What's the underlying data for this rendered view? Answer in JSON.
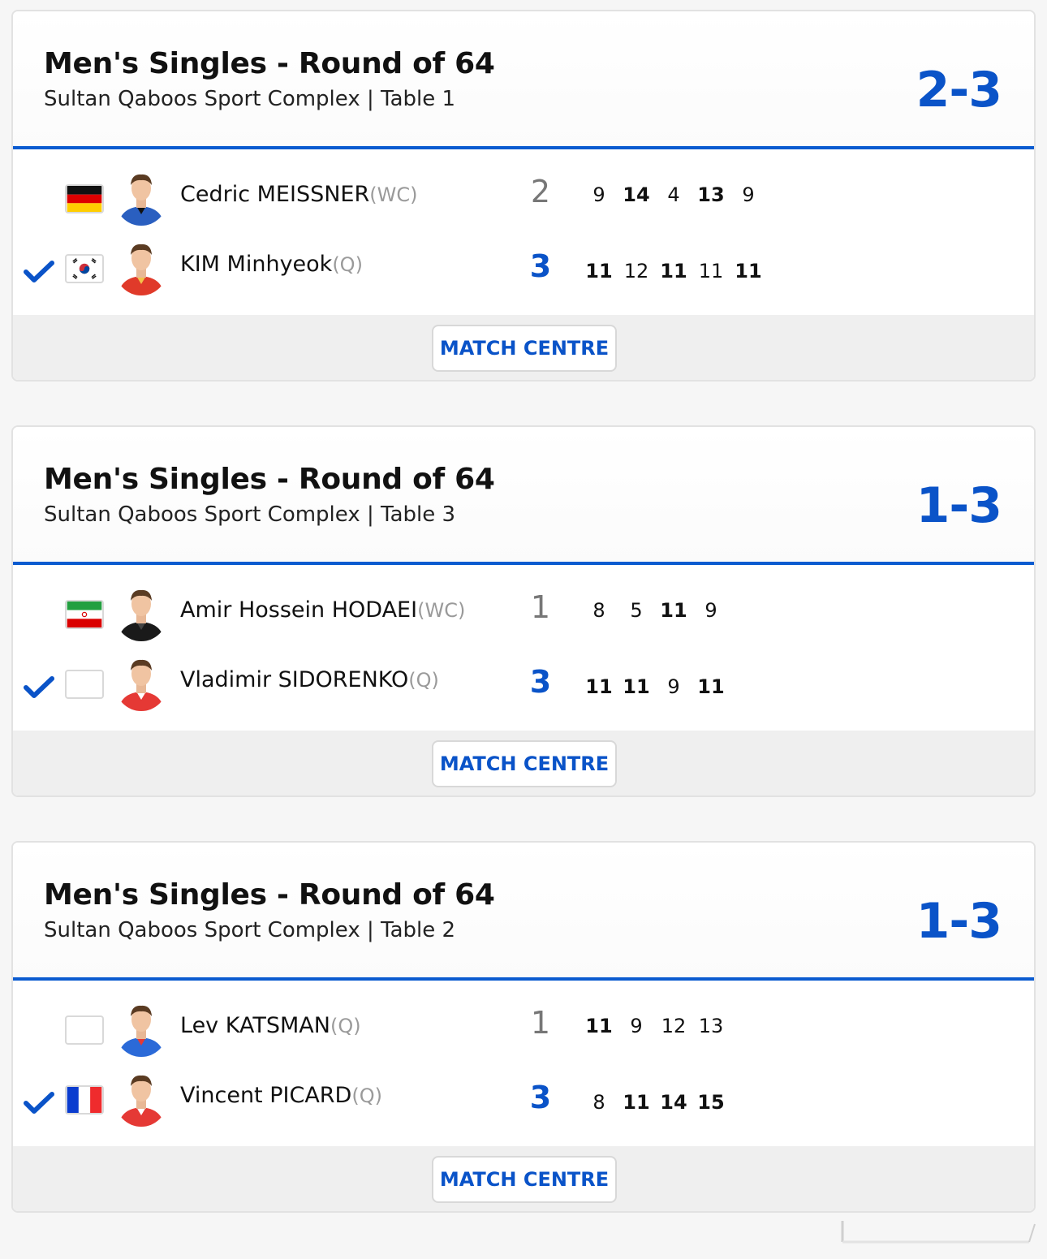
{
  "colors": {
    "accent": "#0a5bd0",
    "score_blue": "#0a53c8",
    "seed_grey": "#9a9a9a"
  },
  "matches": [
    {
      "title": "Men's Singles - Round of 64",
      "subtitle": "Sultan Qaboos Sport Complex | Table 1",
      "score": "2-3",
      "button": "MATCH CENTRE",
      "players": [
        {
          "name": "Cedric MEISSNER",
          "seed": "(WC)",
          "flag": "germany-flag",
          "sets": "2",
          "winner": false,
          "games": [
            [
              "9",
              false
            ],
            [
              "14",
              true
            ],
            [
              "4",
              false
            ],
            [
              "13",
              true
            ],
            [
              "9",
              false
            ]
          ]
        },
        {
          "name": "KIM Minhyeok",
          "seed": "(Q)",
          "flag": "korea-flag",
          "sets": "3",
          "winner": true,
          "games": [
            [
              "11",
              true
            ],
            [
              "12",
              false
            ],
            [
              "11",
              true
            ],
            [
              "11",
              false
            ],
            [
              "11",
              true
            ]
          ]
        }
      ]
    },
    {
      "title": "Men's Singles - Round of 64",
      "subtitle": "Sultan Qaboos Sport Complex | Table 3",
      "score": "1-3",
      "button": "MATCH CENTRE",
      "players": [
        {
          "name": "Amir Hossein HODAEI",
          "seed": "(WC)",
          "flag": "iran-flag",
          "sets": "1",
          "winner": false,
          "games": [
            [
              "8",
              false
            ],
            [
              "5",
              false
            ],
            [
              "11",
              true
            ],
            [
              "9",
              false
            ]
          ]
        },
        {
          "name": "Vladimir SIDORENKO",
          "seed": "(Q)",
          "flag": "blank-flag",
          "sets": "3",
          "winner": true,
          "games": [
            [
              "11",
              true
            ],
            [
              "11",
              true
            ],
            [
              "9",
              false
            ],
            [
              "11",
              true
            ]
          ]
        }
      ]
    },
    {
      "title": "Men's Singles - Round of 64",
      "subtitle": "Sultan Qaboos Sport Complex | Table 2",
      "score": "1-3",
      "button": "MATCH CENTRE",
      "players": [
        {
          "name": "Lev KATSMAN",
          "seed": "(Q)",
          "flag": "blank-flag",
          "sets": "1",
          "winner": false,
          "games": [
            [
              "11",
              true
            ],
            [
              "9",
              false
            ],
            [
              "12",
              false
            ],
            [
              "13",
              false
            ]
          ]
        },
        {
          "name": "Vincent PICARD",
          "seed": "(Q)",
          "flag": "france-flag",
          "sets": "3",
          "winner": true,
          "games": [
            [
              "8",
              false
            ],
            [
              "11",
              true
            ],
            [
              "14",
              true
            ],
            [
              "15",
              true
            ]
          ]
        }
      ]
    }
  ]
}
